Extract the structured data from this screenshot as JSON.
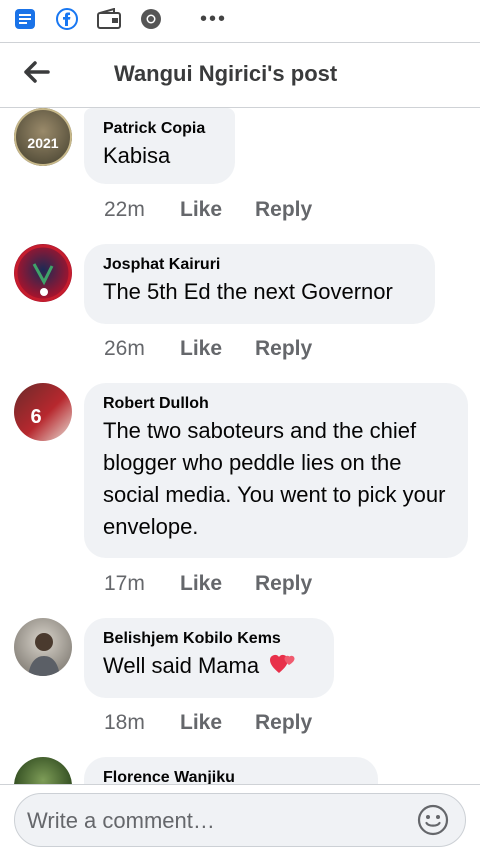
{
  "header": {
    "title": "Wangui Ngirici's post"
  },
  "comments": [
    {
      "name": "Patrick Copia",
      "text": "Kabisa",
      "time": "22m",
      "like": "Like",
      "reply": "Reply",
      "avatar_text": "2021"
    },
    {
      "name": "Josphat Kairuri",
      "text": "The 5th Ed the next Governor",
      "time": "26m",
      "like": "Like",
      "reply": "Reply"
    },
    {
      "name": "Robert Dulloh",
      "text": "The two saboteurs and the chief blogger who peddle lies on the social media. You went to pick your envelope.",
      "time": "17m",
      "like": "Like",
      "reply": "Reply",
      "avatar_text": "6"
    },
    {
      "name": "Belishjem Kobilo Kems",
      "text": "Well said Mama",
      "time": "18m",
      "like": "Like",
      "reply": "Reply"
    },
    {
      "name": "Florence Wanjiku",
      "text": ""
    }
  ],
  "composer": {
    "placeholder": "Write a comment…"
  },
  "colors": {
    "facebook_blue": "#1877f2",
    "bubble": "#f0f2f5",
    "meta": "#65676b"
  }
}
